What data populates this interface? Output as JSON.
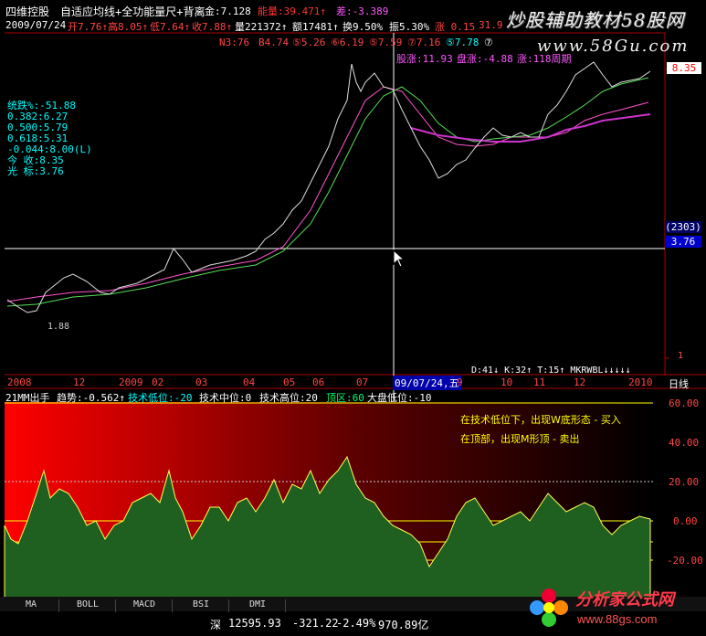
{
  "header": {
    "stock_name": "四维控股",
    "indicator_name": "自适应均线+全功能量尺+背离",
    "gold_label": "金:7.128",
    "energy_label": "能量:39.471↑",
    "diff_label": "差:-3.389",
    "row2": {
      "date": "2009/07/24",
      "open": "开7.76↑",
      "high": "高8.05↑",
      "low": "低7.64↑",
      "close": "收7.88↑",
      "volume": "量221372↑",
      "amount": "额17481↑",
      "turnover": "换9.50%",
      "amplitude": "振5.30%",
      "change": "涨 0.15",
      "pct": "31.9"
    },
    "row3": {
      "n3": "N3:76",
      "b4": "B4.74",
      "c5": "⑤5.26",
      "c6": "⑥6.19",
      "c7a": "⑤7.59",
      "c7b": "⑦7.16",
      "c8": "⑤7.78",
      "c9": "⑦"
    },
    "row4": {
      "stock_up": "股涨:11.93",
      "market_up": "盘涨:-4.88",
      "rise_week": "涨:118周期"
    }
  },
  "left_panel": {
    "lines": [
      "统跌%:-51.88",
      "0.382:6.27",
      "0.500:5.79",
      "0.618:5.31",
      "-0.044:8.00(L)",
      "今 收:8.35",
      "光 标:3.76"
    ]
  },
  "price_badges": {
    "current": "8.35",
    "cursor_code": "(2303)",
    "cursor_price": "3.76",
    "low_mark": "1.88",
    "axis_one": "1"
  },
  "time_axis": {
    "labels": [
      "2008",
      "12",
      "2009",
      "02",
      "03",
      "04",
      "05",
      "06",
      "07",
      "09/07/24,五",
      "9",
      "10",
      "11",
      "12",
      "2010",
      "日线"
    ],
    "indicators": "D:41↓ K:32↑ T:15↑ MKRWBL↓↓↓↓↓"
  },
  "sub_header": {
    "name": "21MM出手",
    "trend": "趋势:-0.562↑",
    "low": "技术低位:-20",
    "mid": "技术中位:0",
    "high": "技术高位:20",
    "top": "顶区:60",
    "market": "大盘低位:-10"
  },
  "sub_notes": {
    "line1": "在技术低位下，出现W底形态 - 买入",
    "line2": "在顶部，出现M形顶 - 卖出"
  },
  "sub_axis": [
    "60.00",
    "40.00",
    "20.00",
    "0.00",
    "-20.00"
  ],
  "tabs": [
    "MA",
    "BOLL",
    "MACD",
    "BSI",
    "DMI"
  ],
  "status": {
    "index": "深",
    "value": "12595.93",
    "change": "-321.22",
    "pct": "-2.49%",
    "amount": "970.89亿"
  },
  "watermark": {
    "top1": "炒股辅助教材58股网",
    "top2": "www.58Gu.com",
    "bottom1": "分析家公式网",
    "bottom2": "www.88gs.com"
  },
  "colors": {
    "accent_red": "#ff3333",
    "accent_yellow": "#ffff00",
    "accent_cyan": "#00ffff",
    "fill_green": "#1f5f1f",
    "line_yellow": "#ffff55"
  }
}
